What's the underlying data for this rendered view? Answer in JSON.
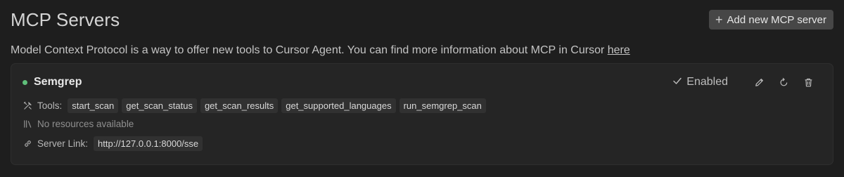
{
  "header": {
    "title": "MCP Servers",
    "add_button_label": "Add new MCP server",
    "add_button_icon": "plus-icon"
  },
  "description": {
    "text": "Model Context Protocol is a way to offer new tools to Cursor Agent. You can find more information about MCP in Cursor ",
    "link_text": "here"
  },
  "server": {
    "name": "Semgrep",
    "status_color": "#5fbf7a",
    "enabled_label": "Enabled",
    "tools_label": "Tools:",
    "tools": [
      "start_scan",
      "get_scan_status",
      "get_scan_results",
      "get_supported_languages",
      "run_semgrep_scan"
    ],
    "resources_text": "No resources available",
    "link_label": "Server Link:",
    "link_url": "http://127.0.0.1:8000/sse",
    "icons": {
      "enabled": "check-icon",
      "edit": "pencil-icon",
      "refresh": "refresh-icon",
      "delete": "trash-icon",
      "tools": "tools-icon",
      "resources": "library-icon",
      "link": "link-icon"
    }
  }
}
